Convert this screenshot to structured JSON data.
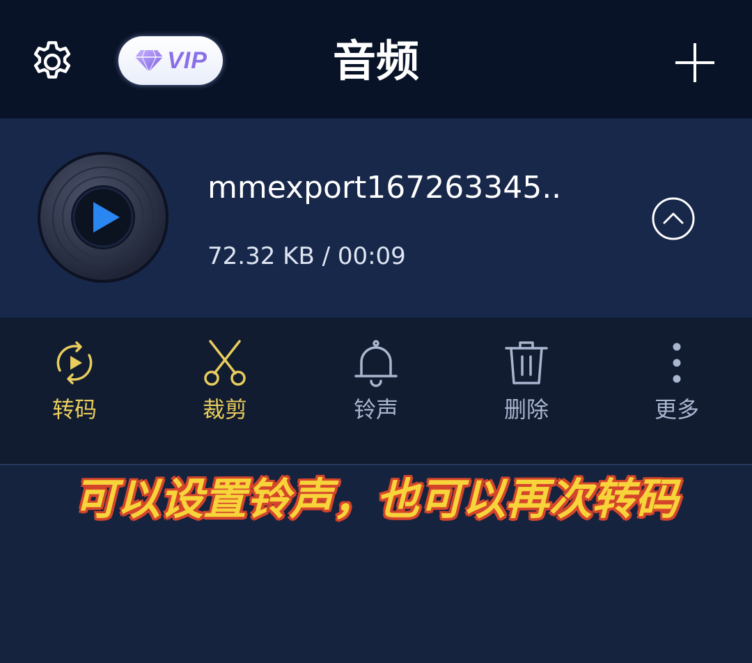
{
  "header": {
    "title": "音频",
    "vip_label": "VIP",
    "icons": {
      "settings": "gear-icon",
      "vip": "diamond-icon",
      "add": "plus-icon"
    }
  },
  "audio_item": {
    "filename": "mmexport167263345..",
    "meta": "72.32 KB / 00:09",
    "icons": {
      "thumbnail": "vinyl-disc-play-icon",
      "collapse": "chevron-up-circle-icon"
    }
  },
  "actions": [
    {
      "label": "转码",
      "icon": "convert-icon",
      "color": "#e9cd5d"
    },
    {
      "label": "裁剪",
      "icon": "scissors-icon",
      "color": "#e9cd5d"
    },
    {
      "label": "铃声",
      "icon": "bell-icon",
      "color": "#a9b6cf"
    },
    {
      "label": "删除",
      "icon": "trash-icon",
      "color": "#a9b6cf"
    },
    {
      "label": "更多",
      "icon": "more-vertical-icon",
      "color": "#a9b6cf"
    }
  ],
  "caption": "可以设置铃声，也可以再次转码",
  "colors": {
    "header_bg": "#091327",
    "list_bg": "#18284a",
    "actions_bg": "#121c30",
    "accent_gold": "#e9cd5d",
    "play_blue": "#2a86f0",
    "caption_yellow": "#f7d43a",
    "caption_outline": "#d5452b"
  }
}
